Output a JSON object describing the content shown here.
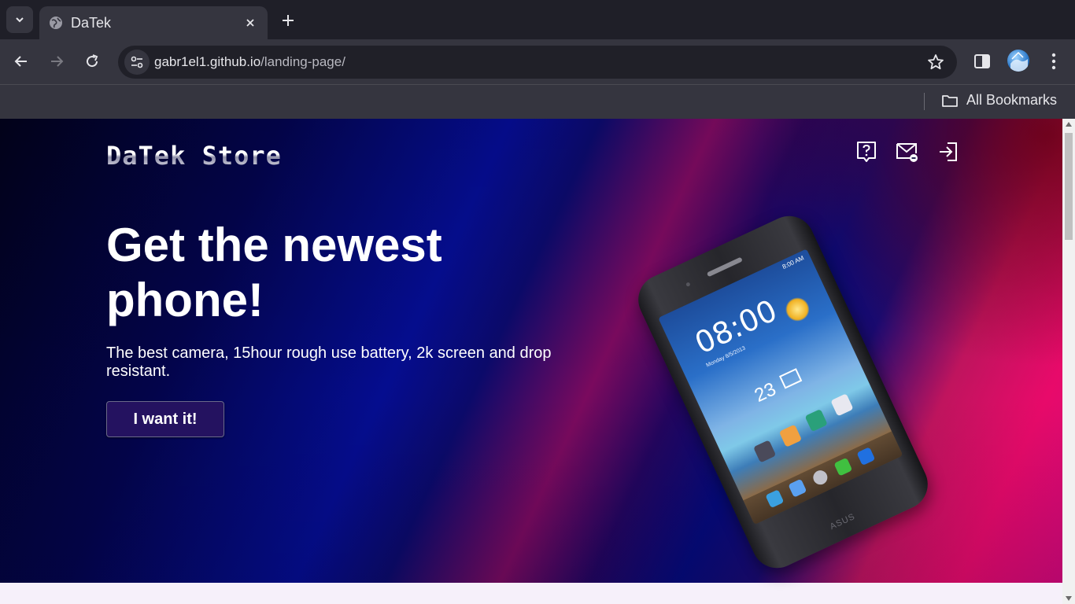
{
  "browser": {
    "tab_title": "DaTek",
    "url_host": "gabr1el1.github.io",
    "url_path": "/landing-page/",
    "bookmarks_label": "All Bookmarks"
  },
  "hero": {
    "logo": "DaTek Store",
    "headline": "Get the newest phone!",
    "subtext": "The best camera, 15hour rough use battery, 2k screen and drop resistant.",
    "cta_label": "I want it!",
    "icons": [
      "help-icon",
      "mail-icon",
      "login-icon"
    ]
  },
  "phone_screen": {
    "status": "8:00 AM",
    "time": "08:00",
    "date": "Monday 8/5/2013",
    "day_number": "23",
    "brand": "ASUS"
  },
  "colors": {
    "chrome_dark": "#1f1f28",
    "chrome_toolbar": "#35353f",
    "cta_background": "#241260",
    "hero_blue": "#050d8f",
    "hero_pink": "#e80a6a"
  }
}
